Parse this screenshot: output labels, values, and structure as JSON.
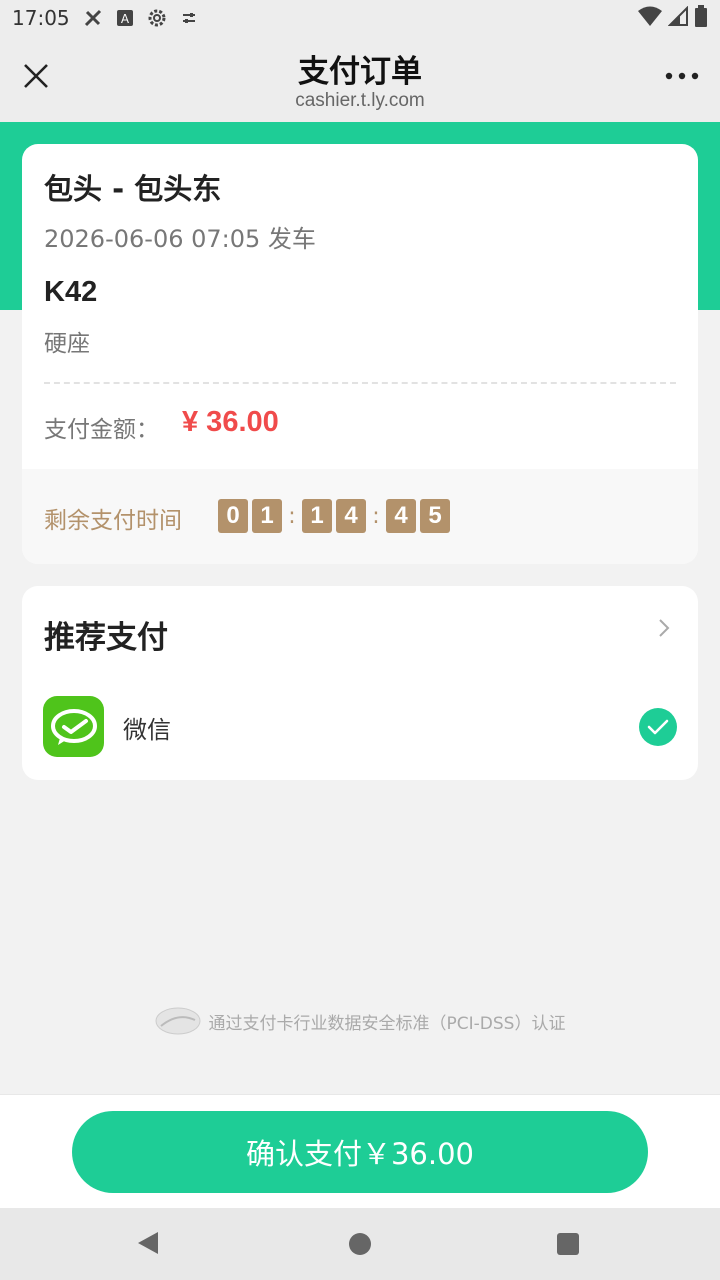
{
  "status_bar": {
    "time": "17:05"
  },
  "nav": {
    "title": "支付订单",
    "url": "cashier.t.ly.com"
  },
  "order": {
    "route": "包头 - 包头东",
    "depart": "2026-06-06 07:05 发车",
    "train_no": "K42",
    "seat": "硬座",
    "amount_label": "支付金额：",
    "amount": "¥ 36.00",
    "timer_label": "剩余支付时间",
    "timer_digits": [
      "0",
      "1",
      "1",
      "4",
      "4",
      "5"
    ],
    "timer_sep": ":"
  },
  "pay": {
    "title": "推荐支付",
    "method": "微信",
    "selected": true
  },
  "pci_text": "通过支付卡行业数据安全标准（PCI-DSS）认证",
  "confirm_label": "确认支付￥36.00",
  "colors": {
    "accent": "#1ecd96",
    "price": "#f04b4b",
    "timer": "#b3926b",
    "wechat": "#4fc41b"
  },
  "icons": {
    "close": "close-icon",
    "more": "more-icon",
    "chevron": "chevron-right-icon",
    "check": "check-icon"
  }
}
